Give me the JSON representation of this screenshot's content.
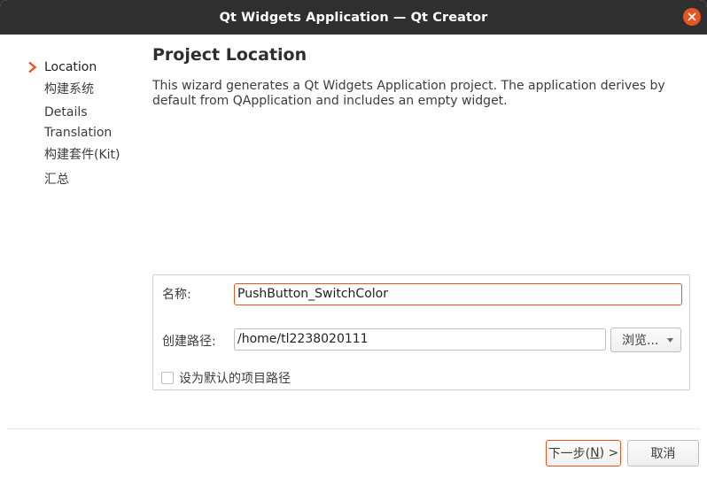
{
  "window": {
    "title": "Qt Widgets Application — Qt Creator",
    "close_icon": "close-icon",
    "accent_color": "#e95420"
  },
  "sidebar": {
    "items": [
      {
        "label": "Location",
        "active": true
      },
      {
        "label": "构建系统",
        "active": false
      },
      {
        "label": "Details",
        "active": false
      },
      {
        "label": "Translation",
        "active": false
      },
      {
        "label": "构建套件(Kit)",
        "active": false
      },
      {
        "label": "汇总",
        "active": false
      }
    ],
    "active_indicator_icon": "chevron-right-icon"
  },
  "main": {
    "title": "Project Location",
    "description": "This wizard generates a Qt Widgets Application project. The application derives by default from QApplication and includes an empty widget."
  },
  "form": {
    "name_label": "名称:",
    "name_value": "PushButton_SwitchColor",
    "path_label": "创建路径:",
    "path_value": "/home/tl2238020111",
    "browse_label": "浏览...",
    "default_path_label": "设为默认的项目路径",
    "default_path_checked": false
  },
  "footer": {
    "next_label_prefix": "下一步(",
    "next_mnemonic": "N",
    "next_label_suffix": ") >",
    "cancel_label": "取消"
  }
}
